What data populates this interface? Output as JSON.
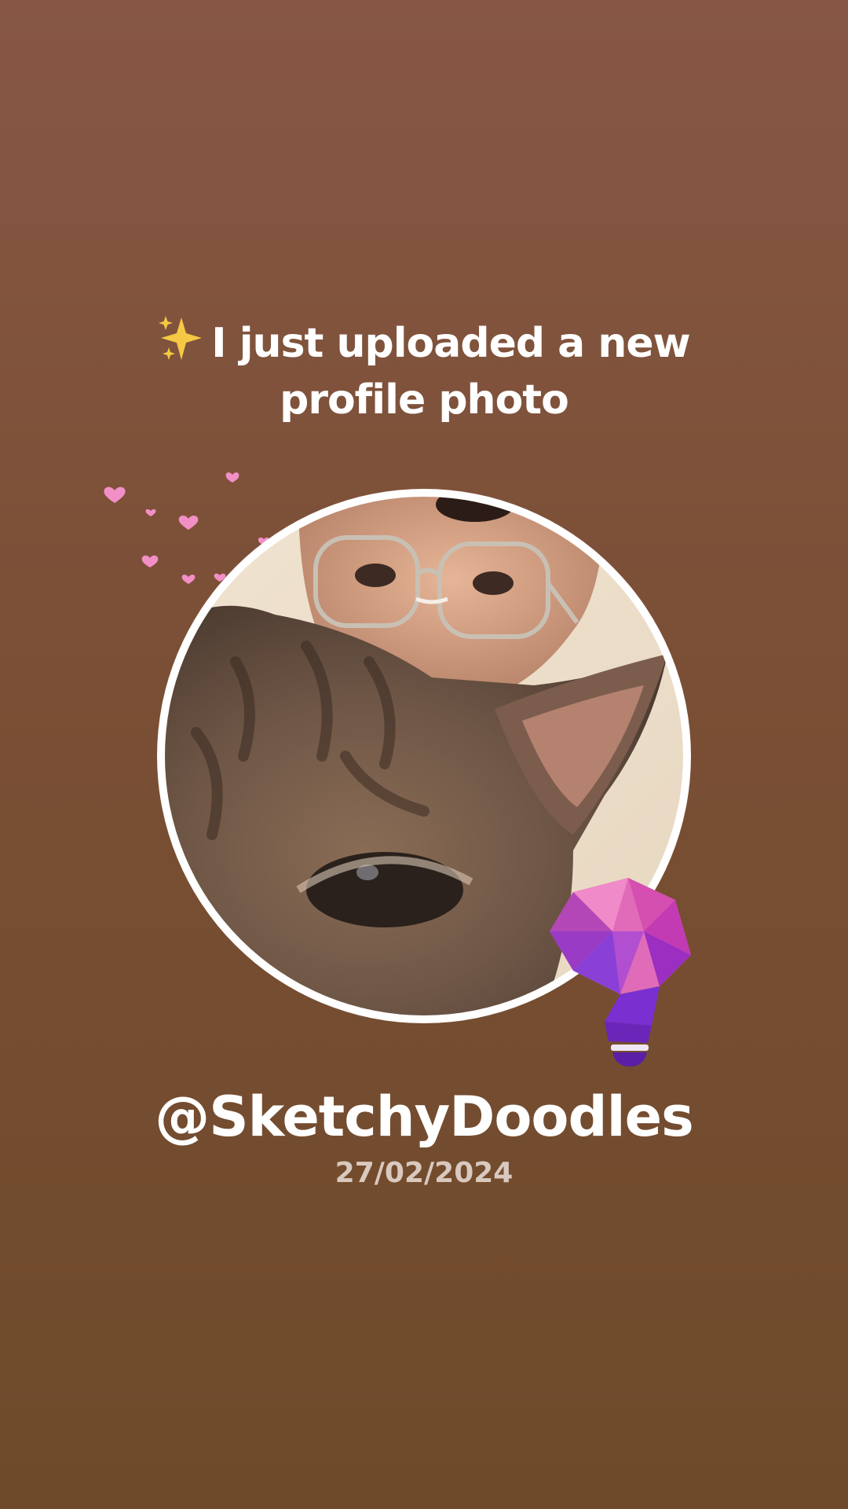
{
  "story": {
    "headline_line1": "I just uploaded a new",
    "headline_line2": "profile photo",
    "username": "@SketchyDoodles",
    "date": "27/02/2024"
  },
  "icons": [
    "sparkles-icon",
    "hearts-decoration",
    "lightbulb-sticker"
  ],
  "colors": {
    "background_top": "#875744",
    "background_bottom": "#6e4a2a",
    "text": "#ffffff",
    "date_text": "#d9c9bf",
    "heart": "#f28fc6",
    "bulb_pink": "#e06bb8",
    "bulb_purple": "#7a2fd0"
  }
}
